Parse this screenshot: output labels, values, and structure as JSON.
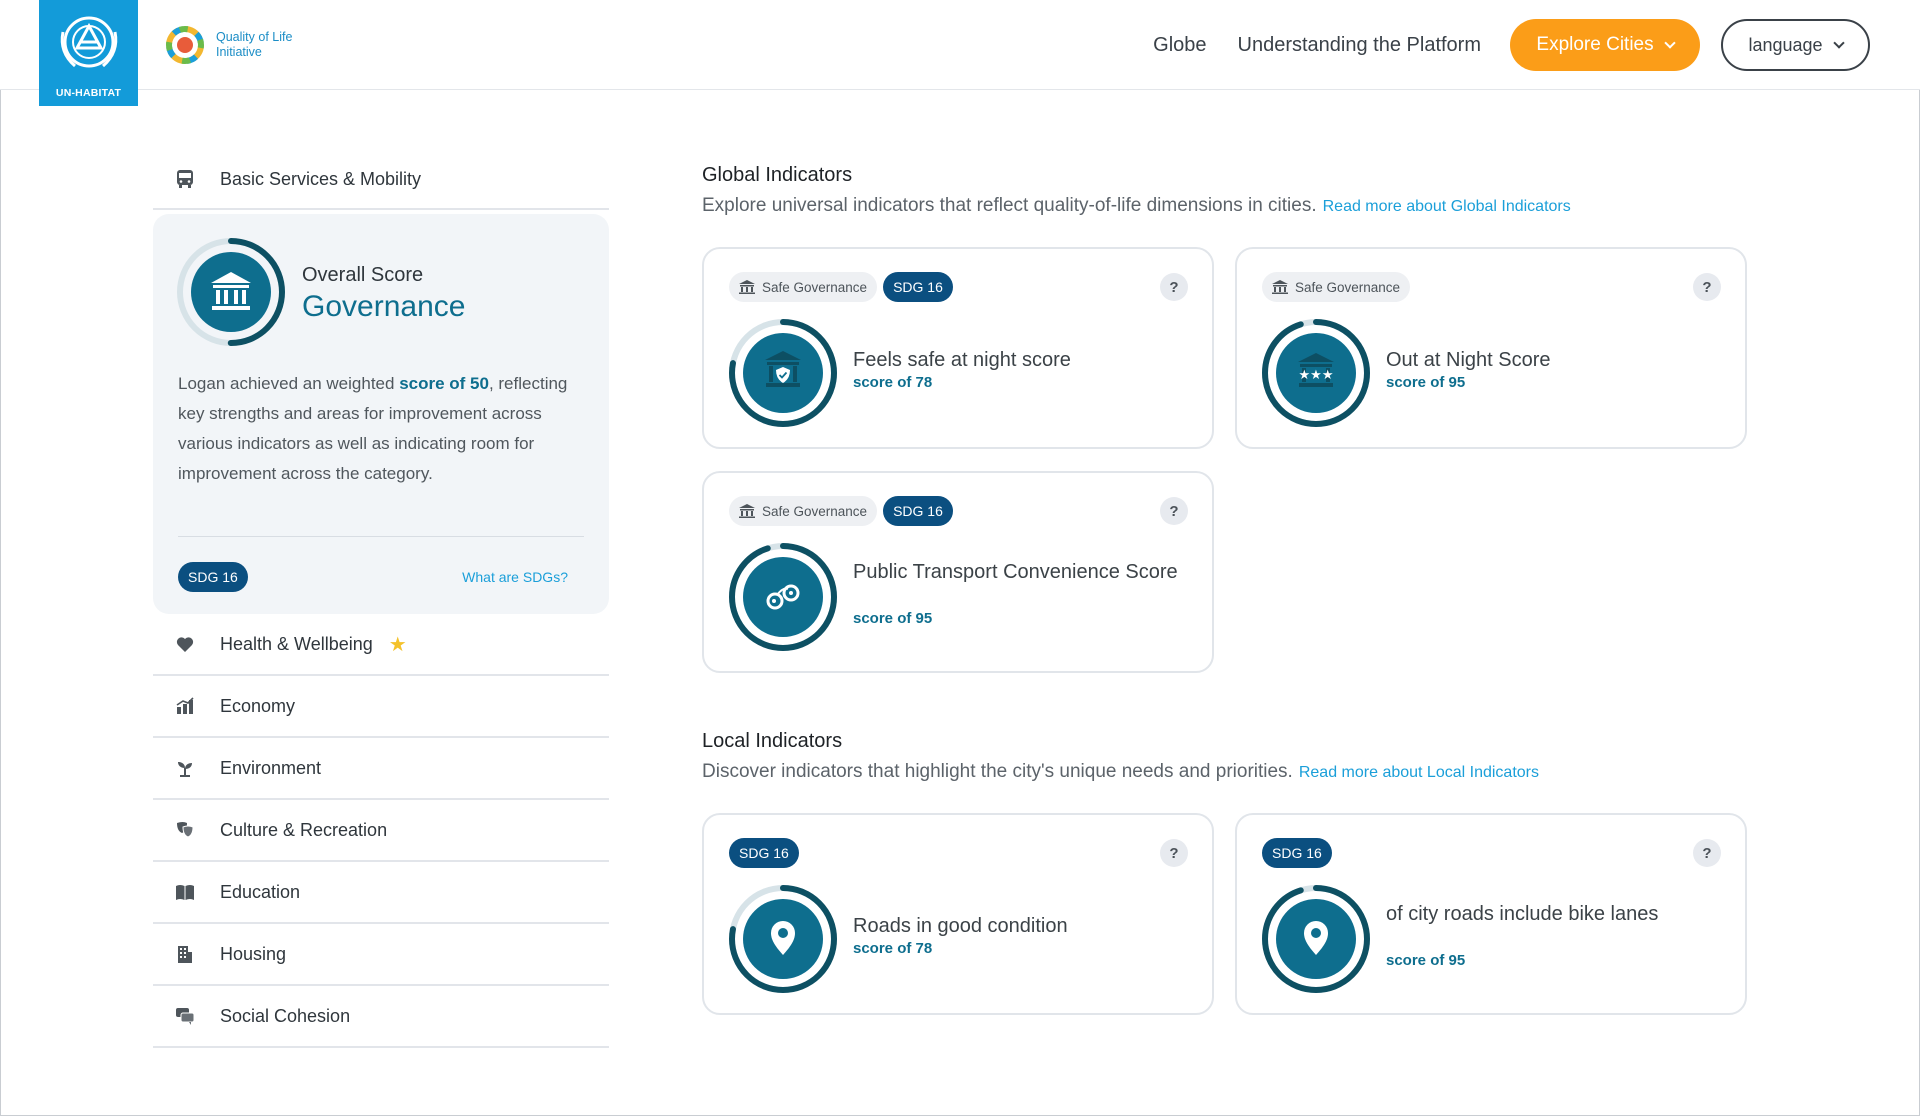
{
  "header": {
    "org_logo_text": "UN-HABITAT",
    "initiative_logo_text": [
      "Quality of Life",
      "Initiative"
    ],
    "nav": {
      "globe": "Globe",
      "understanding": "Understanding the Platform",
      "explore": "Explore Cities",
      "language": "language"
    }
  },
  "sidebar": {
    "top_item": {
      "label": "Basic Services & Mobility",
      "icon": "bus-icon"
    },
    "governance": {
      "overall_label": "Overall Score",
      "title": "Governance",
      "desc_before": "Logan achieved an weighted ",
      "desc_highlight": "score of 50",
      "desc_after": ", reflecting key strengths and areas for improvement across various indicators as well as indicating room for improvement across the category.",
      "sdg": "SDG 16",
      "sdg_link": "What are SDGs?",
      "score": 50
    },
    "items": [
      {
        "label": "Health & Wellbeing",
        "icon": "heart-icon",
        "starred": true
      },
      {
        "label": "Economy",
        "icon": "economy-icon"
      },
      {
        "label": "Environment",
        "icon": "sprout-icon"
      },
      {
        "label": "Culture & Recreation",
        "icon": "masks-icon"
      },
      {
        "label": "Education",
        "icon": "book-icon"
      },
      {
        "label": "Housing",
        "icon": "building-icon"
      },
      {
        "label": "Social Cohesion",
        "icon": "chat-icon"
      }
    ]
  },
  "global": {
    "title": "Global Indicators",
    "subtitle": "Explore universal indicators that reflect quality-of-life dimensions in cities.",
    "link": "Read more about Global Indicators",
    "cards": [
      {
        "tag": "Safe Governance",
        "sdg": "SDG 16",
        "title": "Feels safe at night score",
        "score_text": "score of 78",
        "score": 78,
        "icon": "shield-building-icon"
      },
      {
        "tag": "Safe Governance",
        "sdg": "",
        "title": "Out at Night Score",
        "score_text": "score of 95",
        "score": 95,
        "icon": "stars-building-icon"
      },
      {
        "tag": "Safe Governance",
        "sdg": "SDG 16",
        "title": "Public Transport Convenience Score",
        "score_text": "score of 95",
        "score": 95,
        "icon": "handcuffs-icon"
      }
    ]
  },
  "local": {
    "title": "Local Indicators",
    "subtitle": "Discover indicators that highlight the city's unique needs and priorities.",
    "link": "Read more about Local Indicators",
    "cards": [
      {
        "sdg": "SDG 16",
        "title": "Roads in good condition",
        "score_text": "score of 78",
        "score": 78,
        "icon": "map-pin-icon"
      },
      {
        "sdg": "SDG 16",
        "title": "of city roads include bike lanes",
        "score_text": "score of 95",
        "score": 95,
        "icon": "map-pin-icon"
      }
    ]
  },
  "help_label": "?",
  "colors": {
    "accent": "#0e6e8e",
    "ring_dark": "#0d5063",
    "orange": "#fb9d18",
    "sdg": "#0b4f80",
    "link": "#1b9fd9",
    "unhabitat": "#139bd9"
  }
}
